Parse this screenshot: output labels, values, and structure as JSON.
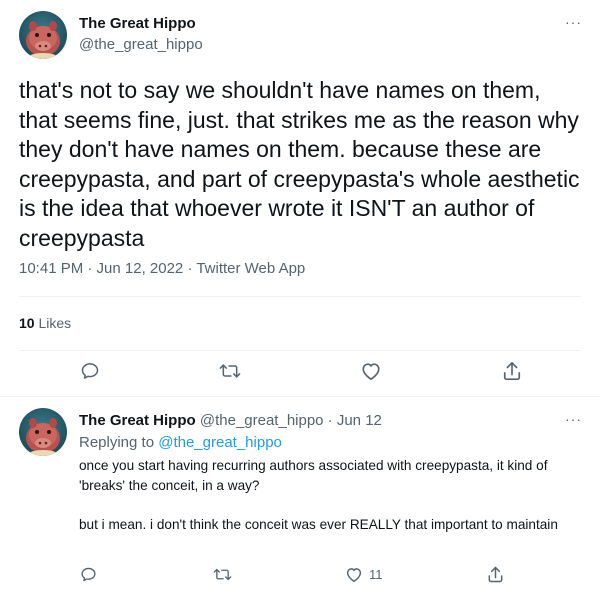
{
  "main_tweet": {
    "author": {
      "name": "The Great Hippo",
      "handle": "@the_great_hippo"
    },
    "more_label": "···",
    "text": "that's not to say we shouldn't have names on them, that seems fine, just. that strikes me as the reason why they don't have names on them. because these are creepypasta, and part of creepypasta's whole aesthetic is the idea that whoever wrote it ISN'T an author of creepypasta",
    "meta": "10:41 PM · Jun 12, 2022 · Twitter Web App",
    "likes": {
      "count": "10",
      "label": "Likes"
    },
    "actions": {
      "reply_icon": "reply-icon",
      "retweet_icon": "retweet-icon",
      "like_icon": "heart-icon",
      "share_icon": "share-icon"
    }
  },
  "reply_tweet": {
    "author": {
      "name": "The Great Hippo",
      "handle_date": "@the_great_hippo · Jun 12"
    },
    "more_label": "···",
    "replying_to_prefix": "Replying to",
    "replying_to_handle": "@the_great_hippo",
    "paragraphs": [
      "once you start having recurring authors associated with creepypasta, it kind of 'breaks' the conceit, in a way?",
      "but i mean. i don't think the conceit was ever REALLY that important to maintain"
    ],
    "actions": {
      "like_count": "11"
    }
  },
  "colors": {
    "text": "#0f1419",
    "secondary": "#536471",
    "link": "#1d9bf0",
    "divider": "#eff3f4"
  }
}
